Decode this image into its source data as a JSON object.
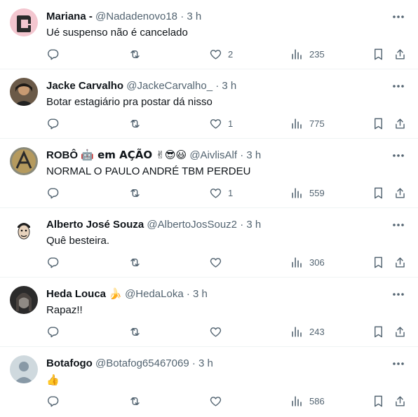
{
  "colors": {
    "text": "#0f1419",
    "meta": "#536471",
    "divider": "#eff3f4"
  },
  "tweets": [
    {
      "name": "Mariana -",
      "emojis": "",
      "handle": "@Nadadenovo18",
      "time": "· 3 h",
      "text": "Ué suspenso não é cancelado",
      "likes": "2",
      "views": "235"
    },
    {
      "name": "Jacke Carvalho",
      "emojis": "",
      "handle": "@JackeCarvalho_",
      "time": "· 3 h",
      "text": "Botar estagiário pra postar dá nisso",
      "likes": "1",
      "views": "775"
    },
    {
      "name": "ROBÔ",
      "emojis": "🤖 em AÇÃO ✌😎😃",
      "handle": "@AivlisAlf",
      "time": "· 3 h",
      "text": "NORMAL O PAULO ANDRÉ TBM PERDEU",
      "likes": "1",
      "views": "559"
    },
    {
      "name": "Alberto José Souza",
      "emojis": "",
      "handle": "@AlbertoJosSouz2",
      "time": "· 3 h",
      "text": "Quê besteira.",
      "likes": "",
      "views": "306"
    },
    {
      "name": "Heda Louca",
      "emojis": "🍌",
      "handle": "@HedaLoka",
      "time": "· 3 h",
      "text": "Rapaz!!",
      "likes": "",
      "views": "243"
    },
    {
      "name": "Botafogo",
      "emojis": "",
      "handle": "@Botafog65467069",
      "time": "· 3 h",
      "text": "👍",
      "likes": "",
      "views": "586"
    }
  ],
  "icons": {
    "more": "more-icon",
    "reply": "reply-icon",
    "retweet": "retweet-icon",
    "like": "heart-icon",
    "views": "views-icon",
    "bookmark": "bookmark-icon",
    "share": "share-icon"
  }
}
